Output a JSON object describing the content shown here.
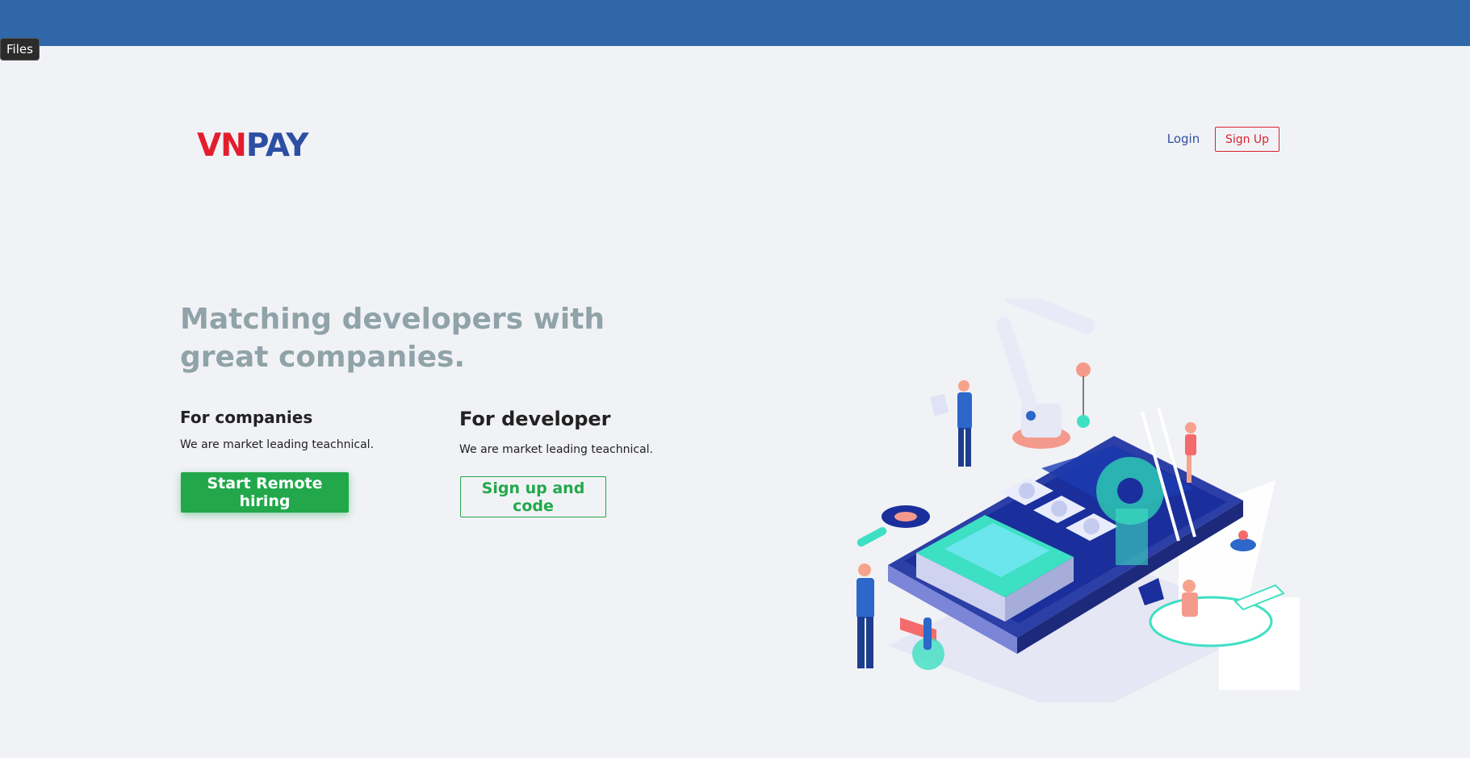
{
  "chrome": {
    "files_label": "Files"
  },
  "header": {
    "logo_part1": "VN",
    "logo_part2": "PAY",
    "login_label": "Login",
    "signup_label": "Sign Up"
  },
  "hero": {
    "title": "Matching developers with great companies."
  },
  "companies": {
    "title": "For companies",
    "description": "We are market leading teachnical.",
    "cta_label": "Start Remote hiring"
  },
  "developer": {
    "title": "For developer",
    "description": "We are market leading teachnical.",
    "cta_label": "Sign up and code"
  },
  "colors": {
    "topbar": "#2f67a8",
    "logo_red": "#e31e2c",
    "logo_blue": "#2c4fa3",
    "accent_green": "#22a84a",
    "hero_title": "#8fa3a8"
  },
  "illustration": {
    "icon": "isometric-phone-robot-arm-illustration"
  }
}
